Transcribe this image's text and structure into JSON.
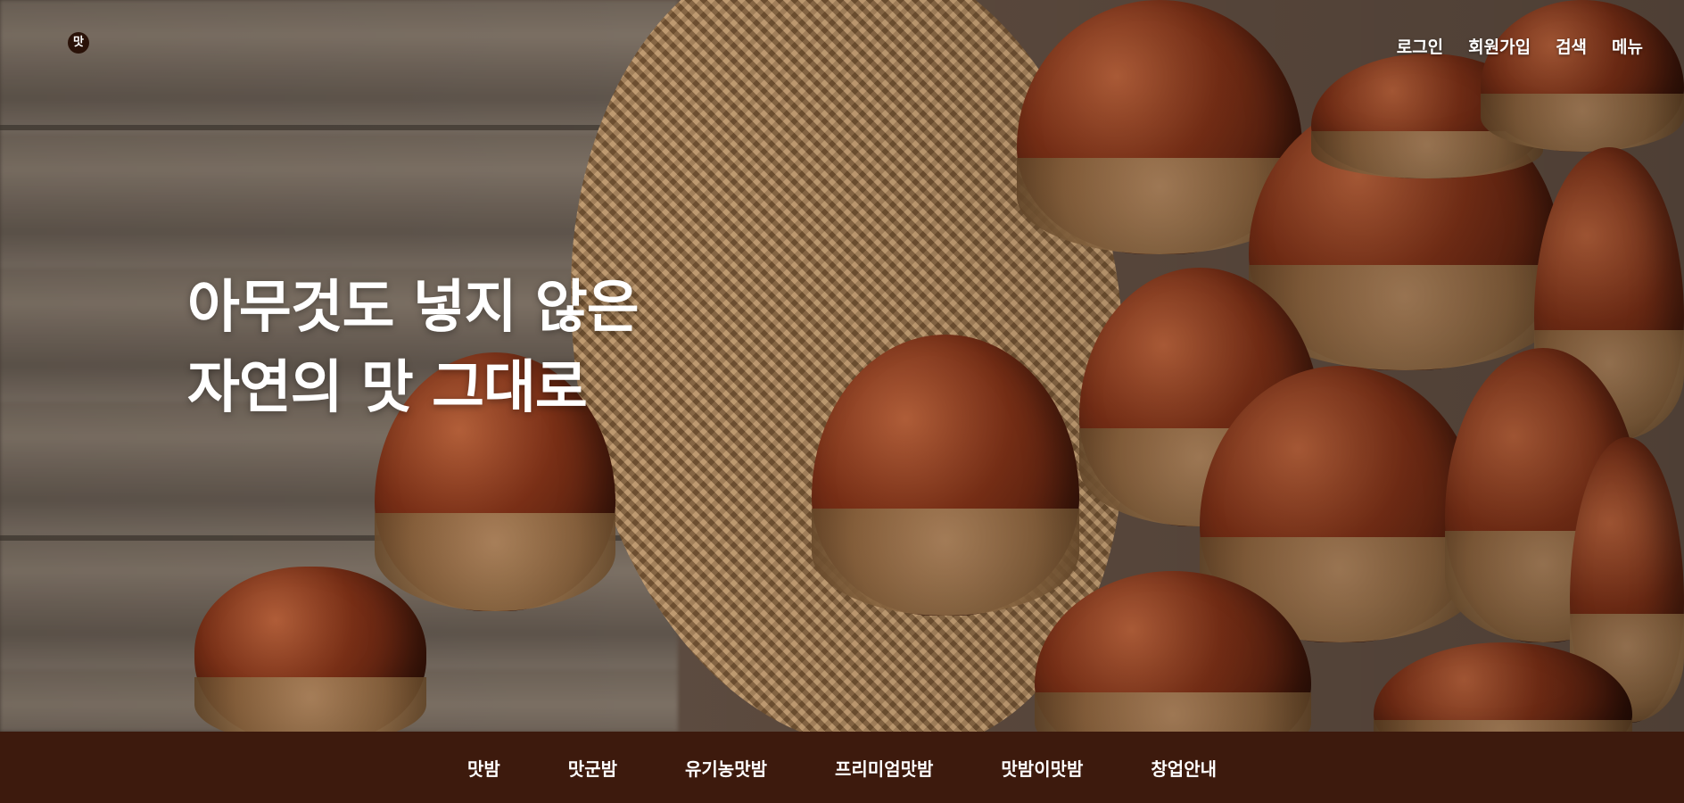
{
  "logo": {
    "glyph": "맛",
    "icon": "brand-logo-icon"
  },
  "utility_nav": [
    "로그인",
    "회원가입",
    "검색",
    "메뉴"
  ],
  "hero": {
    "headline_line1": "아무것도 넣지 않은",
    "headline_line2": "자연의 맛 그대로"
  },
  "main_nav": [
    "맛밤",
    "맛군밤",
    "유기농맛밤",
    "프리미엄맛밤",
    "맛밤이맛밤",
    "창업안내"
  ],
  "colors": {
    "nav_bar": "#3d1a0d",
    "text": "#ffffff"
  }
}
